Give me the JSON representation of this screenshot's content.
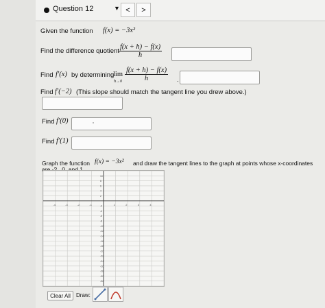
{
  "header": {
    "question_label": "Question 12",
    "prev_label": "<",
    "next_label": ">"
  },
  "problem": {
    "given_text": "Given the function",
    "given_math": "f(x) = −3x²",
    "dq_text": "Find the difference quotient",
    "dq_num": "f(x + h) − f(x)",
    "dq_den": "h",
    "deriv_text_a": "Find",
    "deriv_text_fx": "f′(x)",
    "deriv_text_b": "by determining",
    "lim": "lim",
    "lim_sub": "h→0",
    "deriv_num": "f(x + h) − f(x)",
    "deriv_den": "h",
    "fm2_text_a": "Find",
    "fm2_math": "f′(−2)",
    "fm2_text_b": "(This slope should match the tangent line you drew above.)",
    "f0_text": "Find",
    "f0_math": "f′(0)",
    "f1_text": "Find",
    "f1_math": "f′(1)",
    "graph_text_a": "Graph the function",
    "graph_math": "f(x) = −3x²",
    "graph_text_b": "and draw the tangent lines to the graph at points whose x-coordinates",
    "graph_text_c": "are -2 , 0, and 1."
  },
  "answers": {
    "difference_quotient": "",
    "derivative": "",
    "f_prime_neg2": "",
    "f_prime_0": "",
    "f_prime_1": ""
  },
  "graph": {
    "x_ticks": [
      "-4",
      "-3",
      "-2",
      "-1",
      "1",
      "2",
      "3",
      "4"
    ],
    "y_ticks": [
      "10",
      "8",
      "6",
      "4",
      "2",
      "-2",
      "-4",
      "-6",
      "-8",
      "-10",
      "-12",
      "-14",
      "-16",
      "-18",
      "-20",
      "-22",
      "-24",
      "-26",
      "-28",
      "-30",
      "-32"
    ]
  },
  "toolbar": {
    "clear_label": "Clear All",
    "draw_label": "Draw:",
    "tools": [
      "line-tool-icon",
      "parabola-tool-icon"
    ]
  },
  "colors": {
    "accent_line": "#4a6fa5",
    "parabola_tool": "#c0392b"
  }
}
